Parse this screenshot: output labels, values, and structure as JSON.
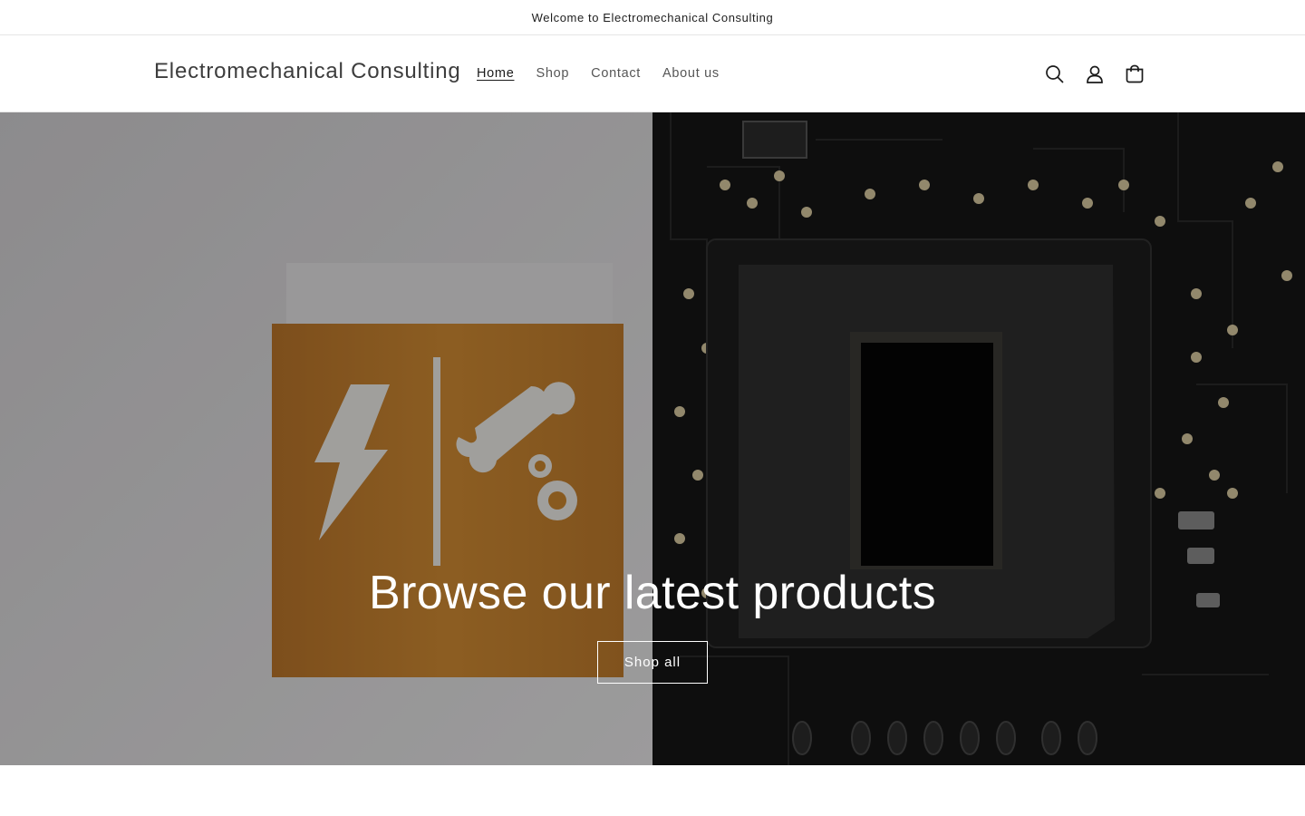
{
  "announcement": {
    "text": "Welcome to Electromechanical Consulting"
  },
  "header": {
    "logo": "Electromechanical Consulting",
    "nav": [
      {
        "label": "Home",
        "active": true
      },
      {
        "label": "Shop",
        "active": false
      },
      {
        "label": "Contact",
        "active": false
      },
      {
        "label": "About us",
        "active": false
      }
    ],
    "icons": [
      "search-icon",
      "account-icon",
      "cart-icon"
    ]
  },
  "hero": {
    "title": "Browse our latest products",
    "button_label": "Shop all",
    "left_image": "wooden-sign-lightning-wrench-gears-icon",
    "right_image": "circuit-board-chip-image"
  },
  "colors": {
    "text": "#121212",
    "wood": "#c27f2c",
    "board": "#151515",
    "pad_gold": "#d8c9a0"
  }
}
